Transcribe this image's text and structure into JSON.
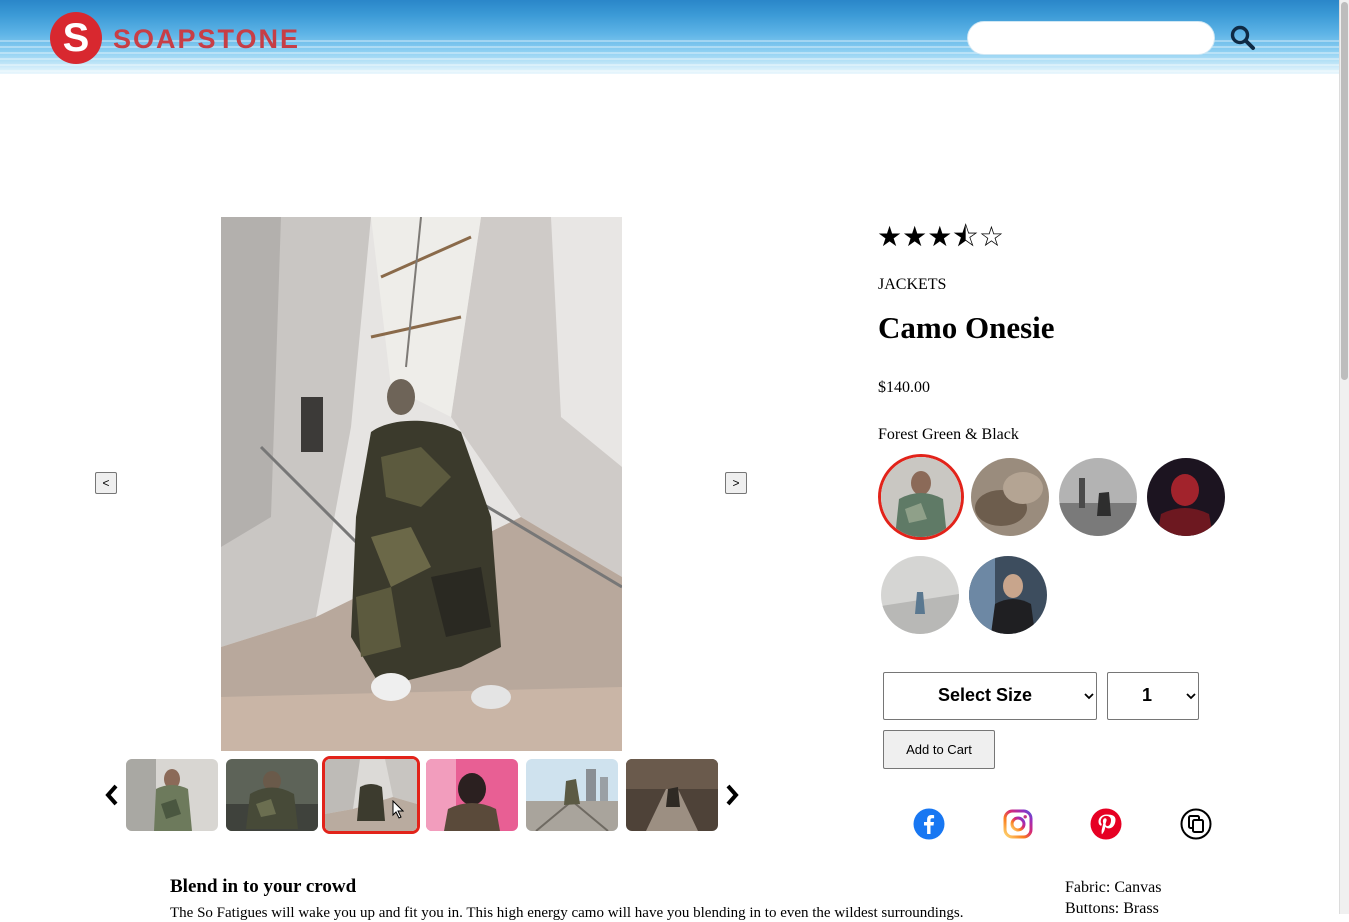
{
  "brand": {
    "logo_letter": "S",
    "name": "SOAPSTONE",
    "logo_color": "#d8282f"
  },
  "search": {
    "placeholder": "",
    "value": "",
    "icon": "search-icon"
  },
  "gallery": {
    "prev_label": "<",
    "next_label": ">",
    "selected_thumbnail": 3,
    "thumbnail_count": 6,
    "thumb_prev_icon": "chevron-left-icon",
    "thumb_next_icon": "chevron-right-icon",
    "accent_color": "#e2231a"
  },
  "product": {
    "rating": 3.5,
    "rating_max": 5,
    "stars_text": "★★★⯪☆",
    "category": "JACKETS",
    "name": "Camo Onesie",
    "price": "$140.00",
    "style_name": "Forest Green & Black",
    "style_count": 6,
    "selected_style": 1
  },
  "purchase": {
    "size_label": "Select Size",
    "quantity": "1",
    "add_to_cart": "Add to Cart"
  },
  "share": {
    "icons": [
      "facebook-icon",
      "instagram-icon",
      "pinterest-icon",
      "copy-link-icon"
    ]
  },
  "description": {
    "heading": "Blend in to your crowd",
    "text": "The So Fatigues will wake you up and fit you in. This high energy camo will have you blending in to even the wildest surroundings.",
    "specs": [
      "Fabric: Canvas",
      "Buttons: Brass"
    ]
  }
}
